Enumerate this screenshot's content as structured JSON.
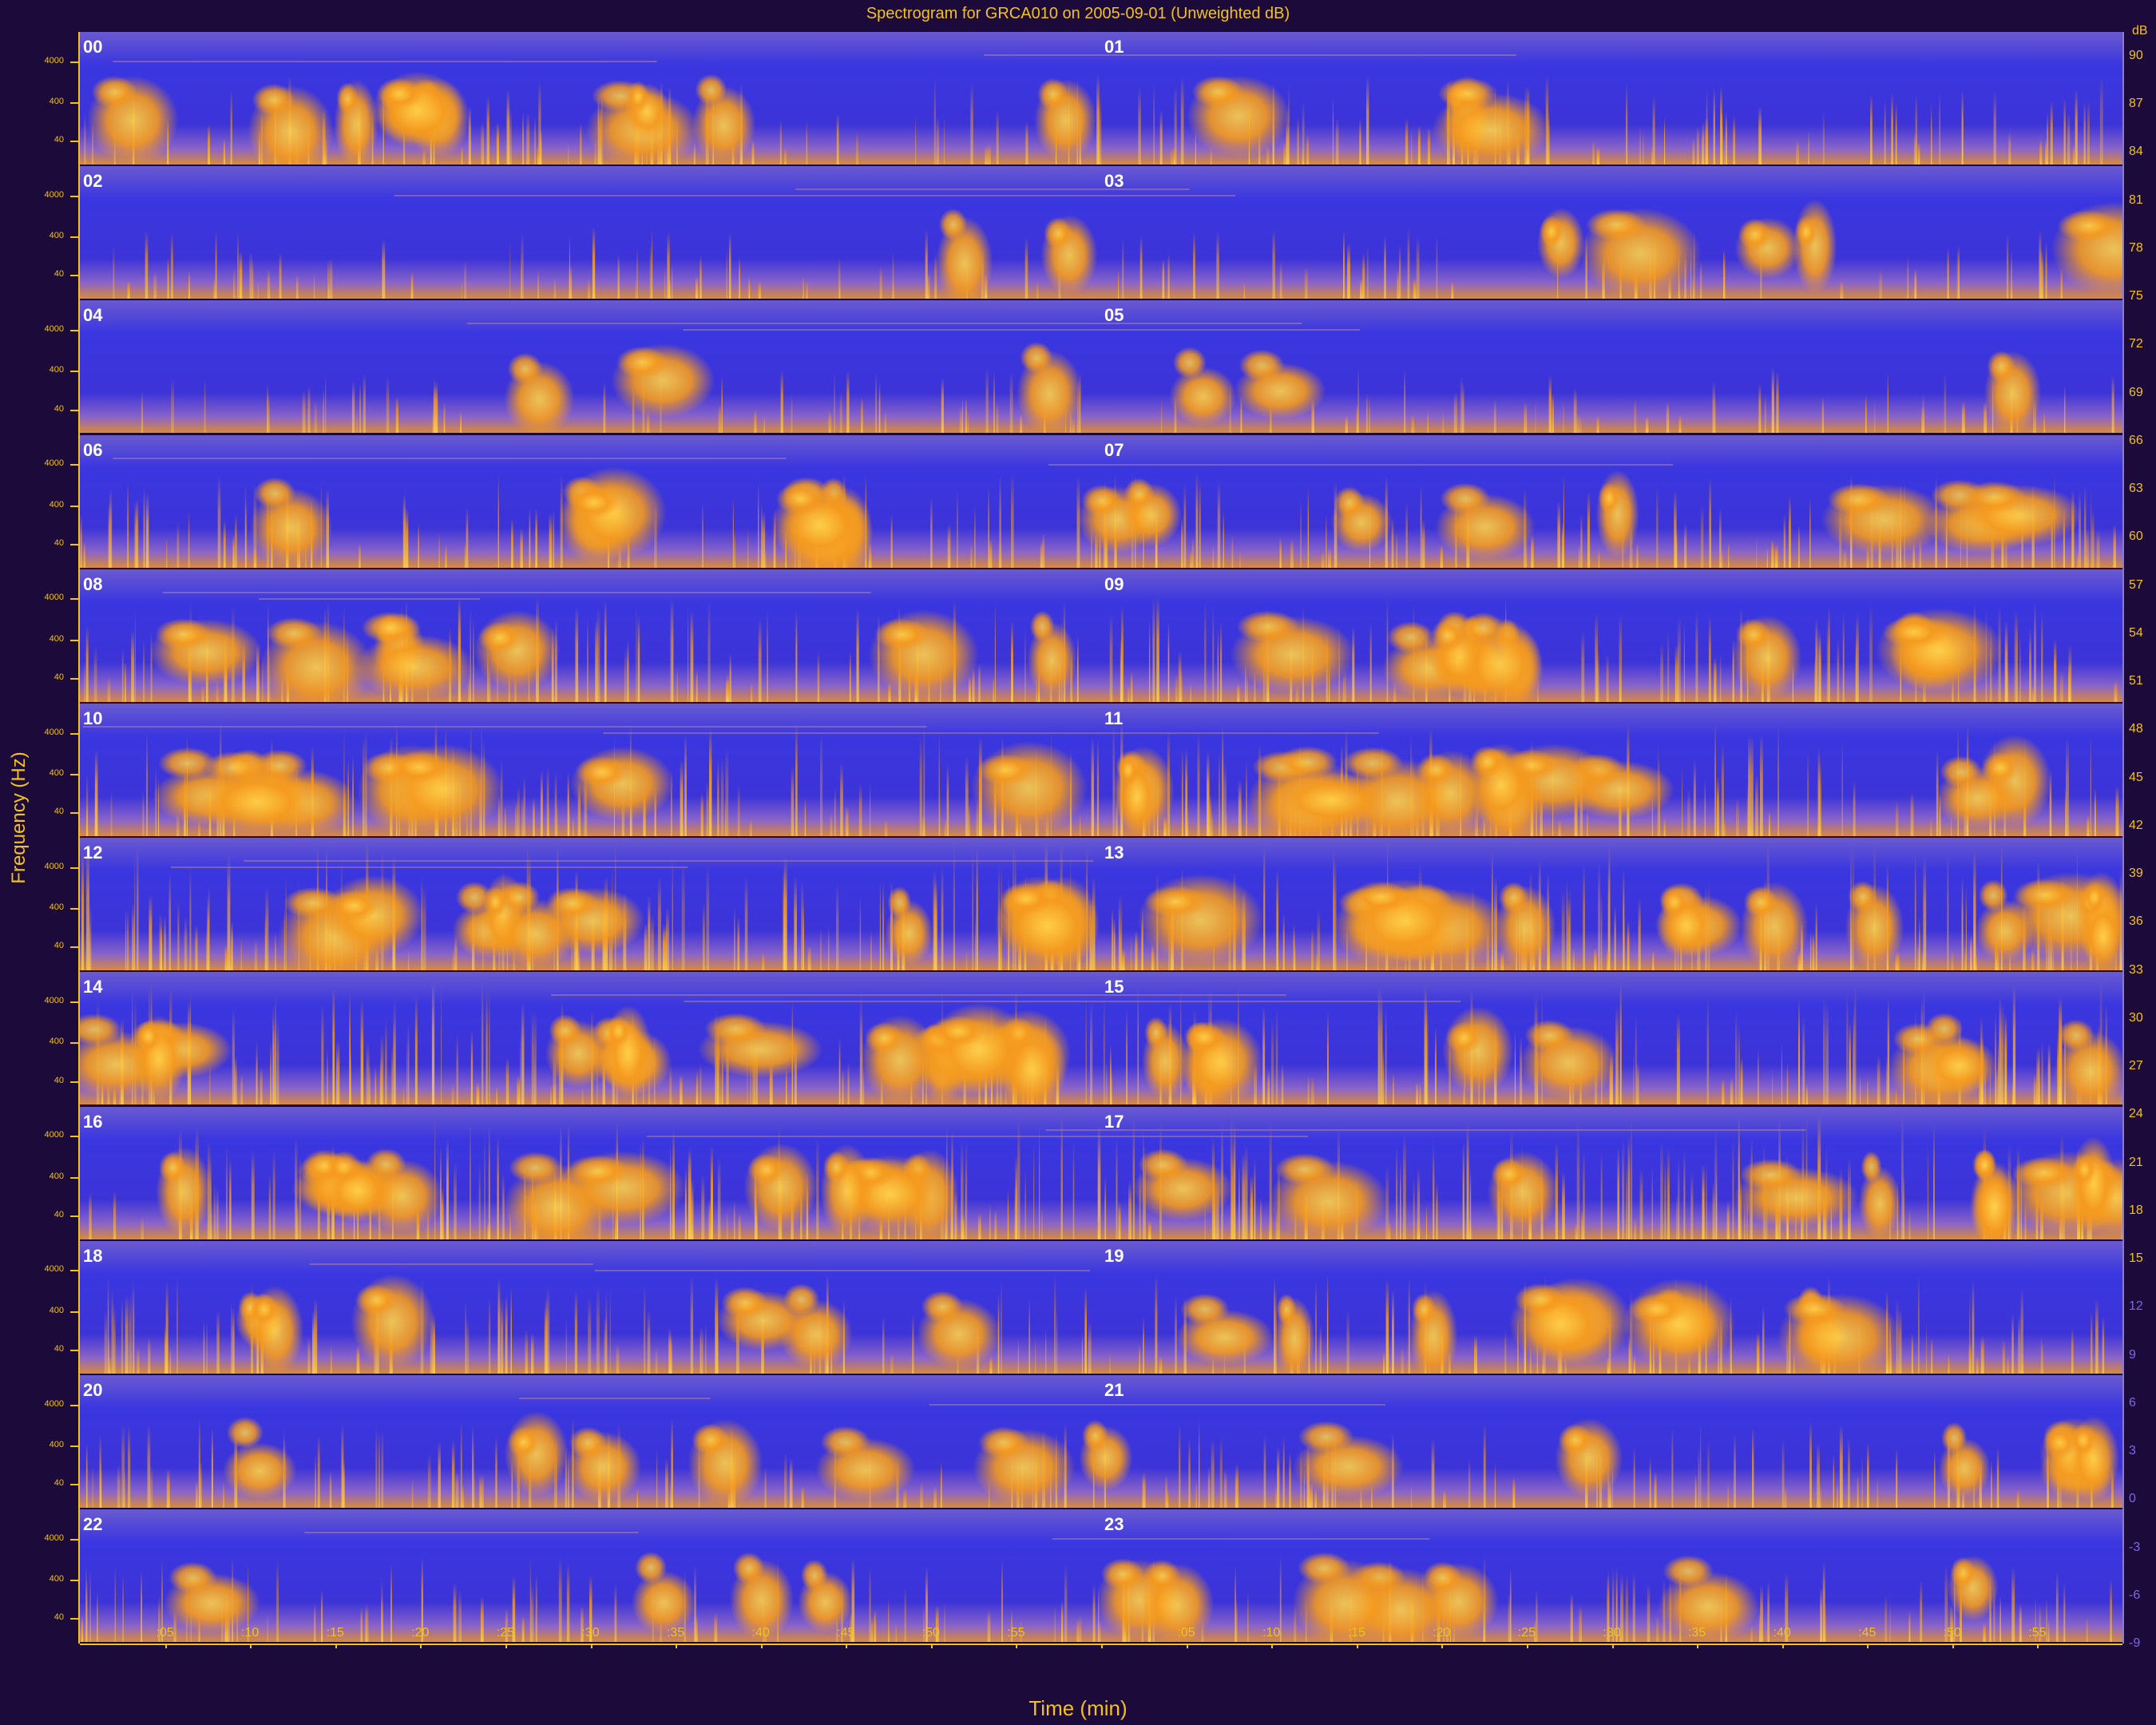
{
  "title": "Spectrogram for GRCA010 on 2005-09-01 (Unweighted dB)",
  "chart_data": {
    "type": "heatmap",
    "title": "Spectrogram for GRCA010 on 2005-09-01 (Unweighted dB)",
    "xlabel": "Time (min)",
    "ylabel": "Frequency (Hz)",
    "y_ticks": [
      "4000",
      "400",
      "40"
    ],
    "x_ticks": [
      ":05",
      ":10",
      ":15",
      ":20",
      ":25",
      ":30",
      ":35",
      ":40",
      ":45",
      ":50",
      ":55",
      "",
      ":05",
      ":10",
      ":15",
      ":20",
      ":25",
      ":30",
      ":35",
      ":40",
      ":45",
      ":50",
      ":55"
    ],
    "x_range_min": [
      0,
      60
    ],
    "rows": [
      {
        "left": "00",
        "right": "01"
      },
      {
        "left": "02",
        "right": "03"
      },
      {
        "left": "04",
        "right": "05"
      },
      {
        "left": "06",
        "right": "07"
      },
      {
        "left": "08",
        "right": "09"
      },
      {
        "left": "10",
        "right": "11"
      },
      {
        "left": "12",
        "right": "13"
      },
      {
        "left": "14",
        "right": "15"
      },
      {
        "left": "16",
        "right": "17"
      },
      {
        "left": "18",
        "right": "19"
      },
      {
        "left": "20",
        "right": "21"
      },
      {
        "left": "22",
        "right": "23"
      }
    ],
    "colorbar": {
      "unit": "dB",
      "ticks": [
        "90",
        "87",
        "84",
        "81",
        "78",
        "75",
        "72",
        "69",
        "66",
        "63",
        "60",
        "57",
        "54",
        "51",
        "48",
        "45",
        "42",
        "39",
        "36",
        "33",
        "30",
        "27",
        "24",
        "21",
        "18",
        "15",
        "12",
        "9",
        "6",
        "3",
        "0",
        "-3",
        "-6",
        "-9"
      ],
      "colors": [
        "#ffd24a",
        "#f59a1e",
        "#8a64c8",
        "#3a36e0",
        "#2b1fd0"
      ]
    },
    "activity_level": [
      0.45,
      0.25,
      0.2,
      0.5,
      0.6,
      0.7,
      0.85,
      0.8,
      0.8,
      0.55,
      0.45,
      0.4
    ]
  }
}
